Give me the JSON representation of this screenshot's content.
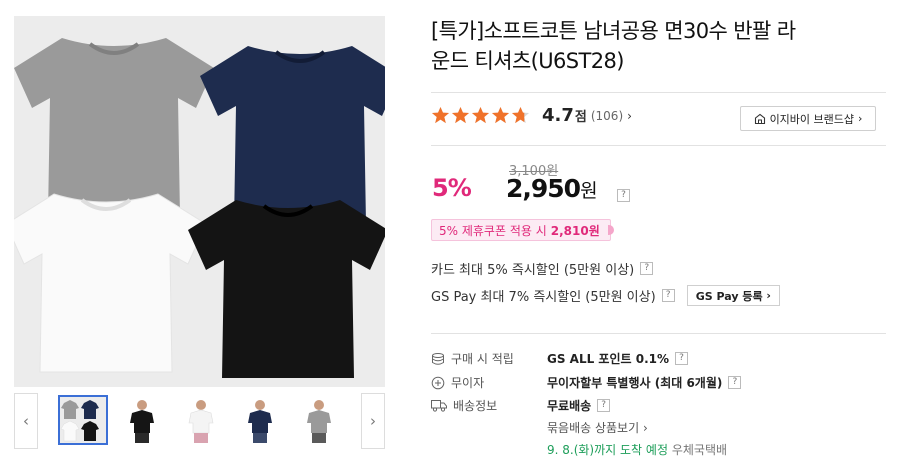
{
  "product": {
    "title_line1": "[특가]소프트코튼 남녀공용 면30수 반팔 라",
    "title_line2": "운드 티셔츠(U6ST28)"
  },
  "rating": {
    "score": "4.7",
    "score_unit": "점",
    "review_count": "(106)",
    "chevron": "›",
    "stars_value": 4.7,
    "stars_max": 5
  },
  "brand_button": {
    "label": "이지바이 브랜드샵",
    "chevron": "›",
    "icon": "store-icon"
  },
  "price": {
    "original": "3,100원",
    "discount_rate": "5%",
    "sale": "2,950",
    "sale_unit": "원",
    "help": "?"
  },
  "coupon": {
    "text": "5% 제휴쿠폰 적용 시",
    "price": "2,810원"
  },
  "benefits": {
    "card": "카드 최대 5% 즉시할인 (5만원 이상)",
    "gspay": "GS Pay 최대 7% 즉시할인 (5만원 이상)",
    "gspay_button": "GS Pay 등록",
    "gspay_button_chevron": "›",
    "help": "?"
  },
  "shipping": {
    "points_label": "구매 시 적립",
    "points_value": "GS ALL 포인트 0.1%",
    "interest_label": "무이자",
    "interest_value": "무이자할부 특별행사 (최대 6개월)",
    "delivery_label": "배송정보",
    "delivery_value": "무료배송",
    "bundle_link": "묶음배송 상품보기",
    "bundle_chevron": "›",
    "eta": "9. 8.(화)까지 도착 예정",
    "carrier": "우체국택배",
    "help": "?"
  },
  "gallery": {
    "prev": "‹",
    "next": "›",
    "selected_thumb": 0,
    "colors": {
      "grey": "#9a9a9a",
      "navy": "#1e2c4e",
      "white": "#fafafa",
      "black": "#141414"
    }
  },
  "theme": {
    "accent": "#e0297a",
    "star": "#f0722a",
    "eta": "#1e9e5a"
  }
}
